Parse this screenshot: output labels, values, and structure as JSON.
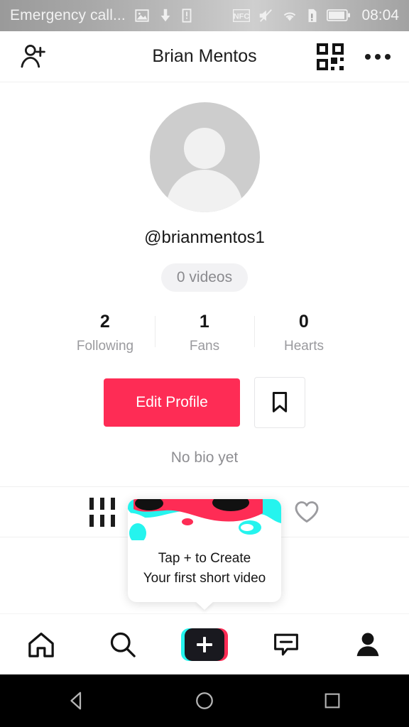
{
  "status_bar": {
    "carrier_text": "Emergency call...",
    "time": "08:04",
    "left_icons": [
      "image-icon",
      "download-icon",
      "sim-card-icon"
    ],
    "right_icons": [
      "nfc-icon",
      "mute-icon",
      "wifi-icon",
      "sd-card-alert-icon",
      "battery-icon"
    ]
  },
  "header": {
    "title": "Brian Mentos",
    "add_person_icon": "add-person-icon",
    "qr_icon": "qr-code-icon",
    "more_icon": "more-options-icon"
  },
  "profile": {
    "avatar_icon": "default-avatar-icon",
    "username": "@brianmentos1",
    "video_count_label": "0 videos",
    "bio": "No bio yet",
    "stats": [
      {
        "value": "2",
        "label": "Following"
      },
      {
        "value": "1",
        "label": "Fans"
      },
      {
        "value": "0",
        "label": "Hearts"
      }
    ],
    "edit_button_label": "Edit Profile",
    "bookmark_icon": "bookmark-icon"
  },
  "tabs": [
    {
      "name": "videos-tab",
      "icon": "grid-bars-icon",
      "active": true
    },
    {
      "name": "liked-tab",
      "icon": "heart-outline-icon",
      "active": false
    }
  ],
  "tooltip": {
    "line1": "Tap + to Create",
    "line2": "Your first short video"
  },
  "bottom_nav": [
    {
      "name": "home",
      "icon": "home-icon"
    },
    {
      "name": "discover",
      "icon": "search-icon"
    },
    {
      "name": "create",
      "icon": "plus-icon"
    },
    {
      "name": "inbox",
      "icon": "inbox-message-icon"
    },
    {
      "name": "profile",
      "icon": "person-filled-icon"
    }
  ],
  "android_nav": [
    {
      "name": "back",
      "icon": "back-triangle-icon"
    },
    {
      "name": "home",
      "icon": "home-circle-icon"
    },
    {
      "name": "recents",
      "icon": "recents-square-icon"
    }
  ],
  "colors": {
    "accent_red": "#fe2c55",
    "accent_cyan": "#25f4ee",
    "text_primary": "#161616",
    "text_secondary": "#9a9a9e"
  }
}
